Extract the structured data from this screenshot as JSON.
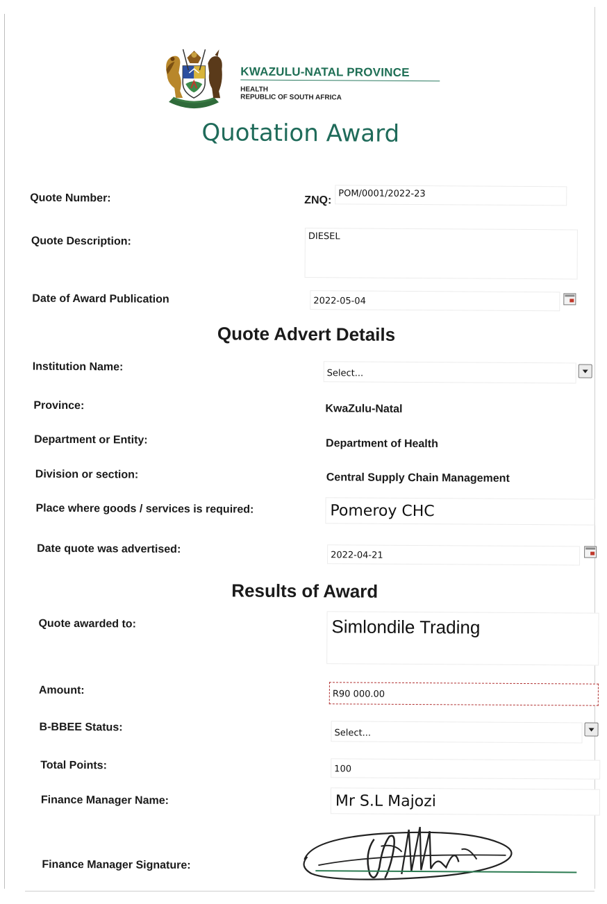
{
  "header": {
    "province": "KWAZULU-NATAL PROVINCE",
    "department": "HEALTH",
    "country": "REPUBLIC OF SOUTH AFRICA",
    "title": "Quotation Award"
  },
  "quote": {
    "number_label": "Quote Number:",
    "number_prefix": "ZNQ:",
    "number_value": "POM/0001/2022-23",
    "description_label": "Quote Description:",
    "description_value": "DIESEL",
    "publication_label": "Date of Award Publication",
    "publication_value": "2022-05-04"
  },
  "advert": {
    "heading": "Quote Advert Details",
    "institution_label": "Institution Name:",
    "institution_value": "Select...",
    "province_label": "Province:",
    "province_value": "KwaZulu-Natal",
    "department_label": "Department or Entity:",
    "department_value": "Department of Health",
    "division_label": "Division or section:",
    "division_value": "Central Supply Chain Management",
    "place_label": "Place where goods /  services is required:",
    "place_value": "Pomeroy CHC",
    "advertised_label": "Date quote was advertised:",
    "advertised_value": "2022-04-21"
  },
  "results": {
    "heading": "Results of Award",
    "awarded_label": "Quote awarded to:",
    "awarded_value": "Simlondile Trading",
    "amount_label": "Amount:",
    "amount_value": "R90 000.00",
    "bbbee_label": "B-BBEE Status:",
    "bbbee_value": "Select...",
    "points_label": "Total Points:",
    "points_value": "100",
    "fm_name_label": "Finance Manager Name:",
    "fm_name_value": "Mr S.L Majozi",
    "fm_signature_label": "Finance Manager Signature:"
  },
  "colors": {
    "brand_green": "#1f6f55",
    "title_green": "#1f6b5a",
    "dashed_border": "#b03030"
  }
}
